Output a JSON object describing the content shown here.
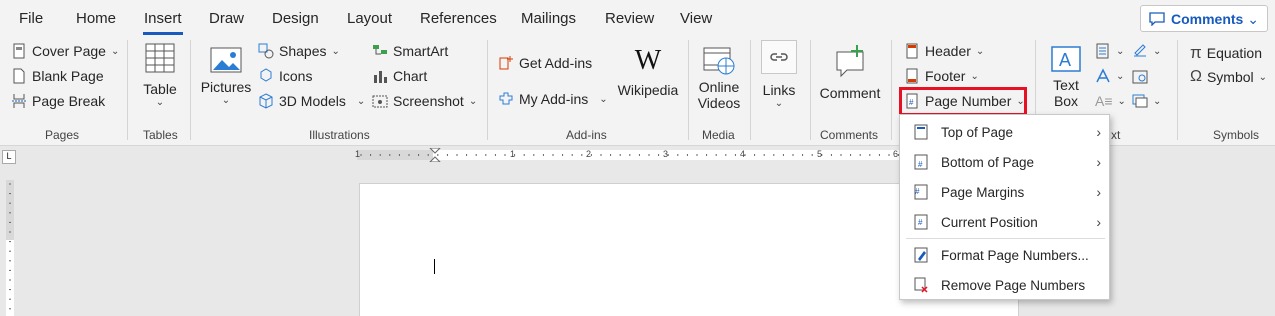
{
  "tabs": [
    "File",
    "Home",
    "Insert",
    "Draw",
    "Design",
    "Layout",
    "References",
    "Mailings",
    "Review",
    "View"
  ],
  "comments_button": {
    "label": "Comments"
  },
  "groups": {
    "pages": {
      "label": "Pages",
      "items": [
        "Cover Page",
        "Blank Page",
        "Page Break"
      ]
    },
    "tables": {
      "label": "Tables",
      "table": "Table"
    },
    "illustrations": {
      "label": "Illustrations",
      "pictures": "Pictures",
      "shapes": "Shapes",
      "icons": "Icons",
      "models": "3D Models",
      "smartart": "SmartArt",
      "chart": "Chart",
      "screenshot": "Screenshot"
    },
    "addins": {
      "label": "Add-ins",
      "get": "Get Add-ins",
      "my": "My Add-ins",
      "wikipedia": "Wikipedia"
    },
    "media": {
      "label": "Media",
      "online_videos_1": "Online",
      "online_videos_2": "Videos"
    },
    "links": {
      "label": "Links"
    },
    "comments": {
      "label": "Comments",
      "comment": "Comment"
    },
    "header_footer": {
      "header": "Header",
      "footer": "Footer",
      "page_number": "Page Number"
    },
    "text": {
      "text_box_1": "Text",
      "text_box_2": "Box",
      "label_fragment": "xt"
    },
    "symbols": {
      "label": "Symbols",
      "equation": "Equation",
      "symbol": "Symbol"
    }
  },
  "ruler": {
    "ticks": [
      "1",
      "1",
      "2",
      "3",
      "4",
      "5",
      "6"
    ]
  },
  "page_number_menu": {
    "items": [
      {
        "label": "Top of Page",
        "submenu": true
      },
      {
        "label": "Bottom of Page",
        "submenu": true
      },
      {
        "label": "Page Margins",
        "submenu": true
      },
      {
        "label": "Current Position",
        "submenu": true
      },
      {
        "label": "Format Page Numbers...",
        "submenu": false
      },
      {
        "label": "Remove Page Numbers",
        "submenu": false
      }
    ]
  },
  "colors": {
    "accent": "#185abd",
    "highlight": "#e81123",
    "ribbon_bg": "#f3f3f3"
  }
}
